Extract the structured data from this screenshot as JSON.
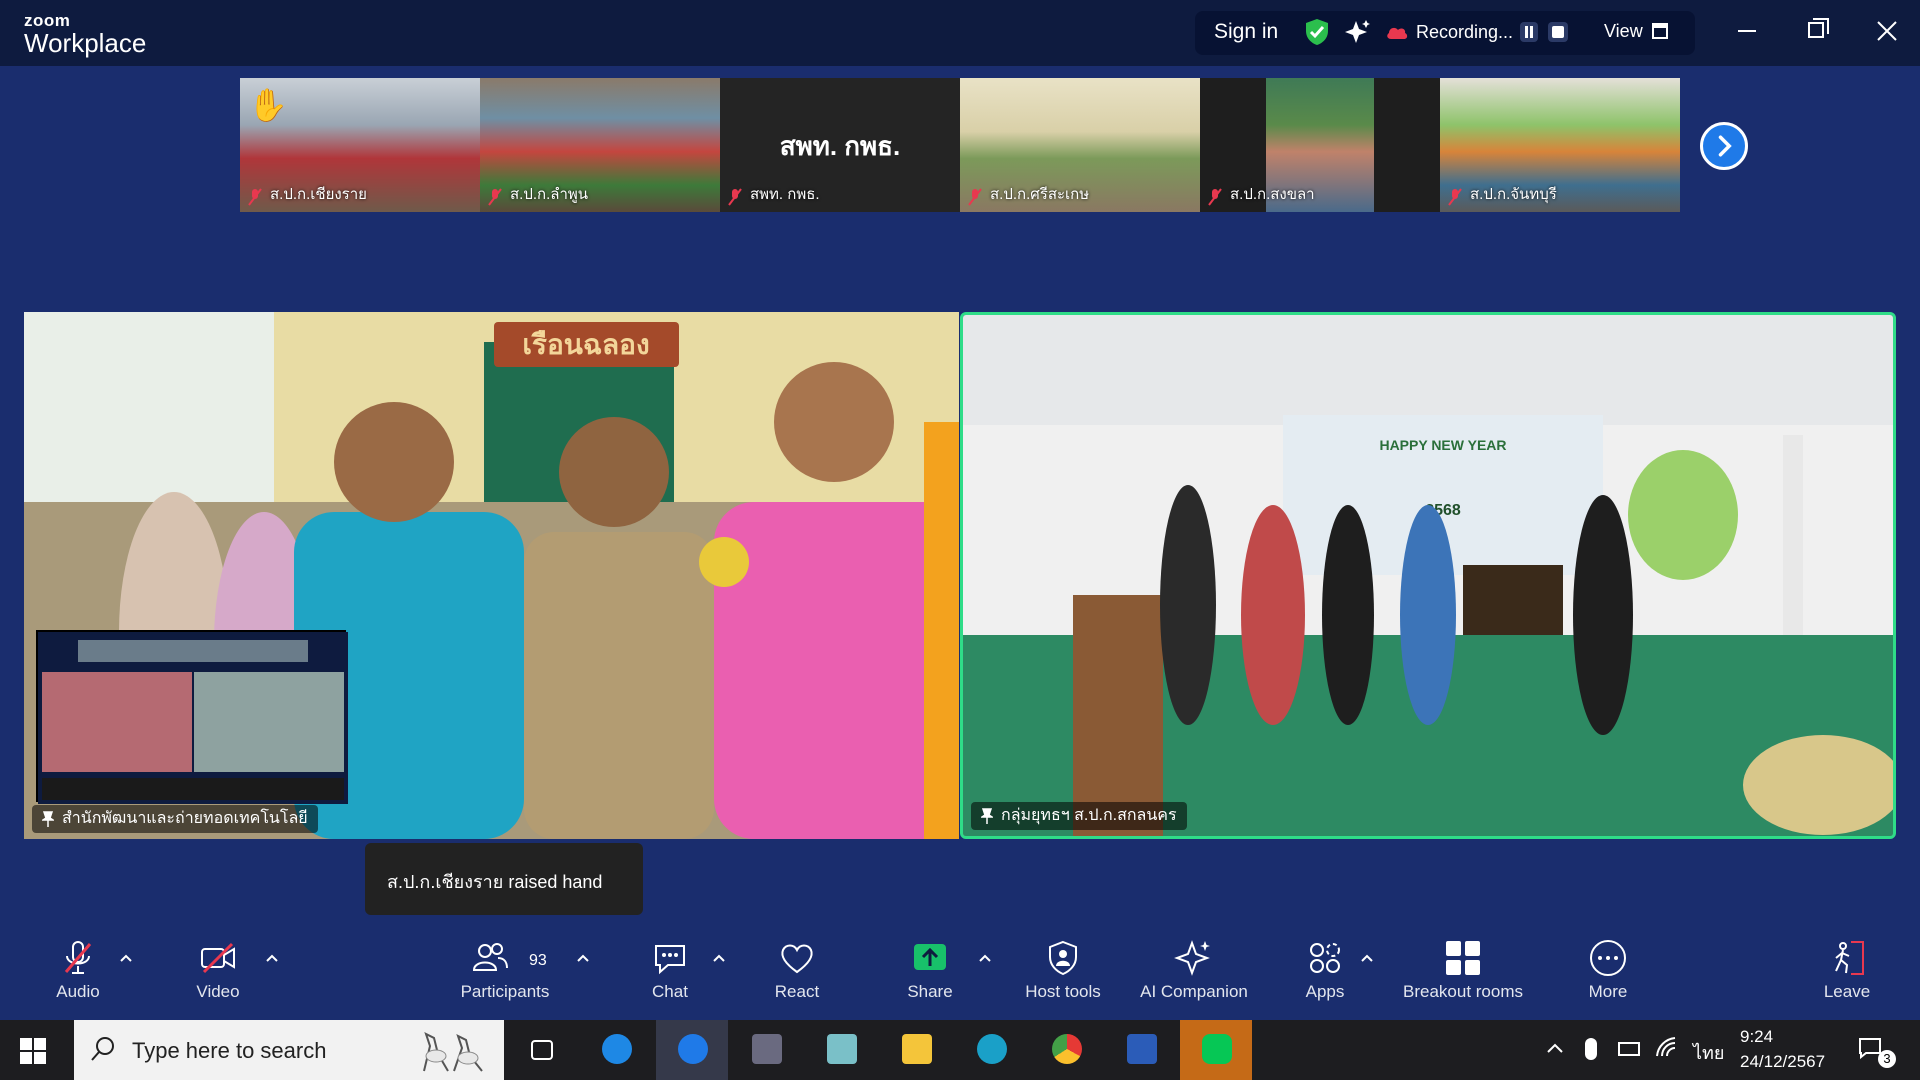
{
  "titlebar": {
    "logo_top": "zoom",
    "logo_bottom": "Workplace",
    "sign_in": "Sign in",
    "recording_label": "Recording...",
    "view_label": "View"
  },
  "gallery_strip": [
    {
      "label": "ส.ป.ก.เชียงราย",
      "hand_raised": true
    },
    {
      "label": "ส.ป.ก.ลำพูน"
    },
    {
      "label": "สพท. กพธ.",
      "video_text": "สพท. กพธ."
    },
    {
      "label": "ส.ป.ก.ศรีสะเกษ"
    },
    {
      "label": "ส.ป.ก.สงขลา"
    },
    {
      "label": "ส.ป.ก.จันทบุรี"
    }
  ],
  "main_tiles": {
    "left": {
      "name": "สำนักพัฒนาและถ่ายทอดเทคโนโลยี",
      "sign_text": "เรือนฉลอง"
    },
    "right": {
      "name": "กลุ่มยุทธฯ ส.ป.ก.สกลนคร",
      "banner_text": "HAPPY NEW YEAR",
      "banner_year": "2568"
    }
  },
  "toast": {
    "text": "ส.ป.ก.เชียงราย raised hand"
  },
  "toolbar": {
    "audio": "Audio",
    "video": "Video",
    "participants": "Participants",
    "participants_count": "93",
    "chat": "Chat",
    "react": "React",
    "share": "Share",
    "host_tools": "Host tools",
    "ai_companion": "AI Companion",
    "apps": "Apps",
    "breakout_rooms": "Breakout rooms",
    "more": "More",
    "leave": "Leave"
  },
  "taskbar": {
    "search_placeholder": "Type here to search",
    "language": "ไทย",
    "time": "9:24",
    "date": "24/12/2567",
    "notification_count": "3"
  },
  "colors": {
    "zoom_blue": "#1f7ae8",
    "share_green": "#18c06a",
    "leave_red": "#e8384f",
    "active_speaker": "#2fdc88"
  }
}
